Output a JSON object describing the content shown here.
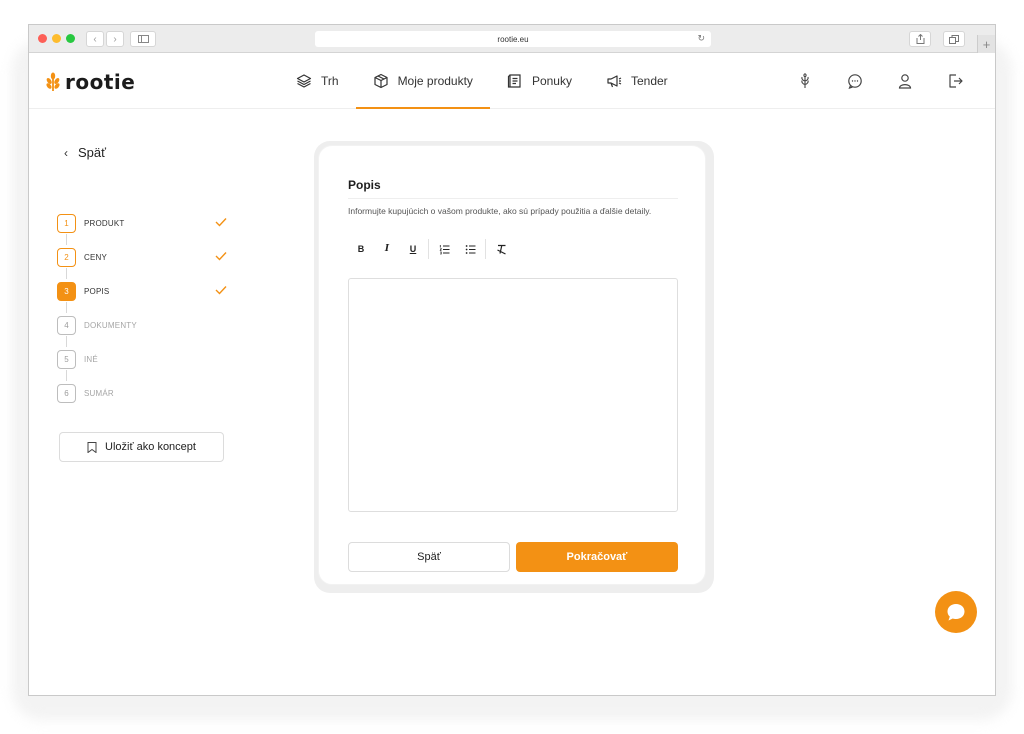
{
  "browser": {
    "url": "rootie.eu"
  },
  "brand": {
    "logo_text": "rootie",
    "accent_color": "#f39114"
  },
  "nav": {
    "items": [
      {
        "label": "Trh",
        "icon": "layers-icon"
      },
      {
        "label": "Moje produkty",
        "icon": "box-icon"
      },
      {
        "label": "Ponuky",
        "icon": "offers-icon"
      },
      {
        "label": "Tender",
        "icon": "megaphone-icon"
      }
    ],
    "active": "Moje produkty"
  },
  "header_icons": [
    "wheat-icon",
    "chat-icon",
    "user-icon",
    "logout-icon"
  ],
  "sidebar": {
    "back_label": "Späť",
    "steps": [
      {
        "number": "1",
        "label": "PRODUKT",
        "status": "done"
      },
      {
        "number": "2",
        "label": "CENY",
        "status": "done"
      },
      {
        "number": "3",
        "label": "POPIS",
        "status": "current"
      },
      {
        "number": "4",
        "label": "DOKUMENTY",
        "status": "pending"
      },
      {
        "number": "5",
        "label": "INÉ",
        "status": "pending"
      },
      {
        "number": "6",
        "label": "SUMÁR",
        "status": "pending"
      }
    ],
    "save_draft_label": "Uložiť ako koncept"
  },
  "card": {
    "title": "Popis",
    "hint": "Informujte kupujúcich o vašom produkte, ako sú prípady použitia a ďalšie detaily.",
    "toolbar": {
      "bold": "B",
      "italic": "I",
      "underline": "U"
    },
    "editor_value": "",
    "back_label": "Späť",
    "continue_label": "Pokračovať"
  }
}
